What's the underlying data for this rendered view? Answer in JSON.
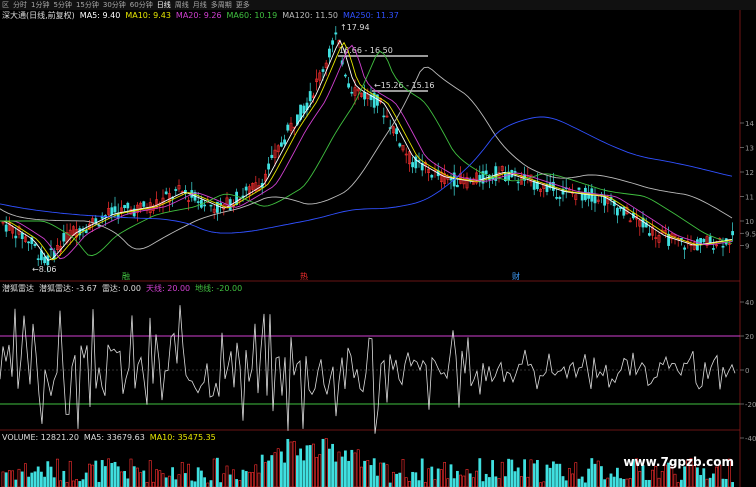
{
  "toolbar": {
    "items": [
      "分时",
      "1分钟",
      "5分钟",
      "15分钟",
      "30分钟",
      "60分钟",
      "日线",
      "周线",
      "月线",
      "多周期",
      "更多"
    ],
    "active_index": 6,
    "prefix": "区"
  },
  "price_panel": {
    "title": "深大通(日线,前复权)",
    "ma": [
      {
        "label": "MA5: 9.40",
        "color": "#ffffff"
      },
      {
        "label": "MA10: 9.43",
        "color": "#e6e600"
      },
      {
        "label": "MA20: 9.26",
        "color": "#d040d0"
      },
      {
        "label": "MA60: 10.19",
        "color": "#40c040"
      },
      {
        "label": "MA120: 11.50",
        "color": "#bbbbbb"
      },
      {
        "label": "MA250: 11.37",
        "color": "#3050ff"
      }
    ],
    "annotations": {
      "high": "17.94",
      "range1": "16.66 - 16.50",
      "range2": "15.26 - 15.16",
      "low": "8.06"
    },
    "right_ticks": [
      "14",
      "13",
      "12",
      "11",
      "10",
      "9.5",
      "9"
    ],
    "event_markers": [
      "融",
      "热",
      "财"
    ]
  },
  "indicator_panel": {
    "name": "潜狐雷达",
    "value_label": "潜狐雷达: -3.67",
    "lines": [
      {
        "label": "雷达: 0.00",
        "color": "#dddddd"
      },
      {
        "label": "天线: 20.00",
        "color": "#d040d0"
      },
      {
        "label": "地线: -20.00",
        "color": "#40c040"
      }
    ],
    "right_ticks": [
      "40",
      "20",
      "0",
      "-20",
      "-40"
    ]
  },
  "volume_panel": {
    "label": "VOLUME: 12821.20",
    "ma": [
      {
        "label": "MA5: 33679.63",
        "color": "#dddddd"
      },
      {
        "label": "MA10: 35475.35",
        "color": "#e6e600"
      }
    ]
  },
  "watermark": "www.7gpzb.com",
  "colors": {
    "up": "#ff3030",
    "down": "#40e0e0",
    "bg": "#000000"
  }
}
